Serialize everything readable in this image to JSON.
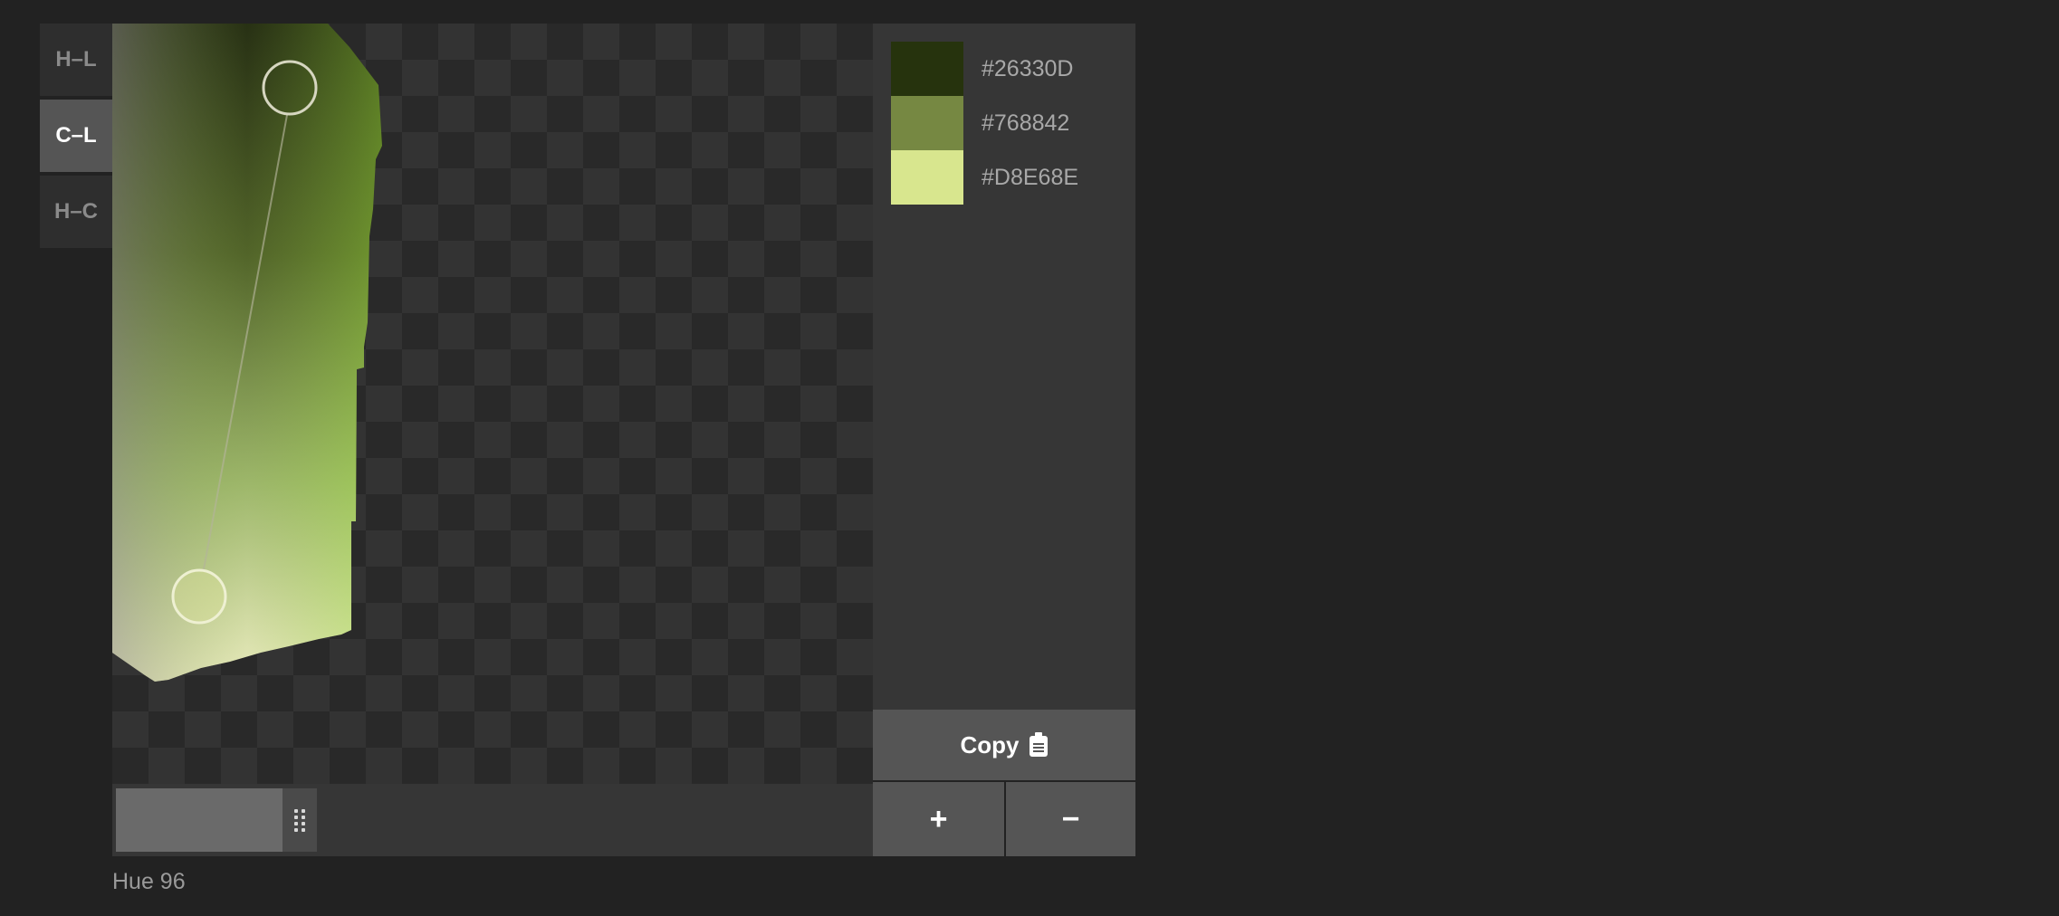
{
  "modes": [
    {
      "label": "H–L",
      "active": false
    },
    {
      "label": "C–L",
      "active": true
    },
    {
      "label": "H–C",
      "active": false
    }
  ],
  "swatches": [
    {
      "hex": "#26330D",
      "color": "#26330D"
    },
    {
      "hex": "#768842",
      "color": "#768842"
    },
    {
      "hex": "#D8E68E",
      "color": "#D8E68E"
    }
  ],
  "copy_label": "Copy",
  "plus_label": "+",
  "minus_label": "−",
  "hue_label": "Hue 96",
  "hue_value": 96,
  "slider_fill_fraction": 0.267,
  "icons": {
    "copy": "clipboard-icon",
    "slider": "grip-icon"
  },
  "colors": {
    "background": "#222222",
    "panel": "#363636",
    "button": "#555555"
  }
}
